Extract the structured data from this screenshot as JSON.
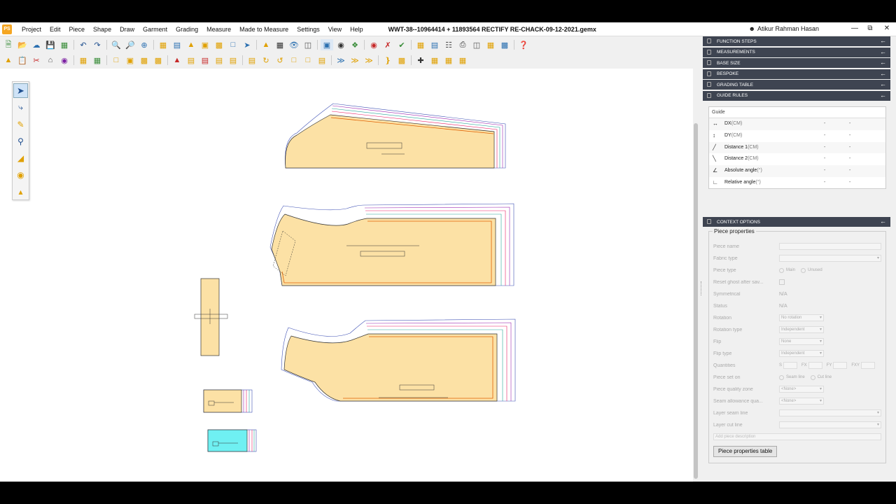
{
  "menubar": {
    "logo": "PS",
    "items": [
      "Project",
      "Edit",
      "Piece",
      "Shape",
      "Draw",
      "Garment",
      "Grading",
      "Measure",
      "Made to Measure",
      "Settings",
      "View",
      "Help"
    ],
    "title": "WWT-38--10964414 + 11893564  RECTIFY RE-CHACK-09-12-2021.gemx",
    "user": "Atikur Rahman Hasan"
  },
  "right_panel": {
    "sections": [
      "FUNCTION STEPS",
      "MEASUREMENTS",
      "BASE SIZE",
      "BESPOKE",
      "GRADING TABLE",
      "GUIDE RULES"
    ],
    "guide": {
      "header": "Guide",
      "rows": [
        {
          "label": "DX",
          "unit": "(CM)",
          "v1": "-",
          "v2": "-"
        },
        {
          "label": "DY",
          "unit": "(CM)",
          "v1": "-",
          "v2": "-"
        },
        {
          "label": "Distance 1",
          "unit": "(CM)",
          "v1": "-",
          "v2": "-"
        },
        {
          "label": "Distance 2",
          "unit": "(CM)",
          "v1": "-",
          "v2": "-"
        },
        {
          "label": "Absolute angle",
          "unit": "(°)",
          "v1": "-",
          "v2": "-"
        },
        {
          "label": "Relative angle",
          "unit": "(°)",
          "v1": "-",
          "v2": "-"
        }
      ]
    },
    "context_header": "CONTEXT OPTIONS",
    "props": {
      "title": "Piece properties",
      "piece_name": "Piece name",
      "fabric_type": "Fabric type",
      "piece_type": "Piece type",
      "piece_type_opt1": "Main",
      "piece_type_opt2": "Unused",
      "reset_ghost": "Reset ghost after sav...",
      "symmetrical": "Symmetrical",
      "symmetrical_val": "N/A",
      "status": "Status",
      "status_val": "N/A",
      "rotation": "Rotation",
      "rotation_val": "No rotation",
      "rotation_type": "Rotation type",
      "rotation_type_val": "Independent",
      "flip": "Flip",
      "flip_val": "None",
      "flip_type": "Flip type",
      "flip_type_val": "Independent",
      "quantities": "Quantities",
      "q_s": "S",
      "q_fx": "FX",
      "q_fy": "FY",
      "q_fxy": "FXY",
      "piece_set_on": "Piece set on",
      "seam_line": "Seam line",
      "cut_line": "Cut line",
      "quality_zone": "Piece quality zone",
      "quality_zone_val": "<None>",
      "seam_allowance": "Seam allowance qua...",
      "seam_allowance_val": "<None>",
      "layer_seam": "Layer seam line",
      "layer_cut": "Layer cut line",
      "description_placeholder": "Add piece description",
      "table_button": "Piece properties table"
    }
  }
}
